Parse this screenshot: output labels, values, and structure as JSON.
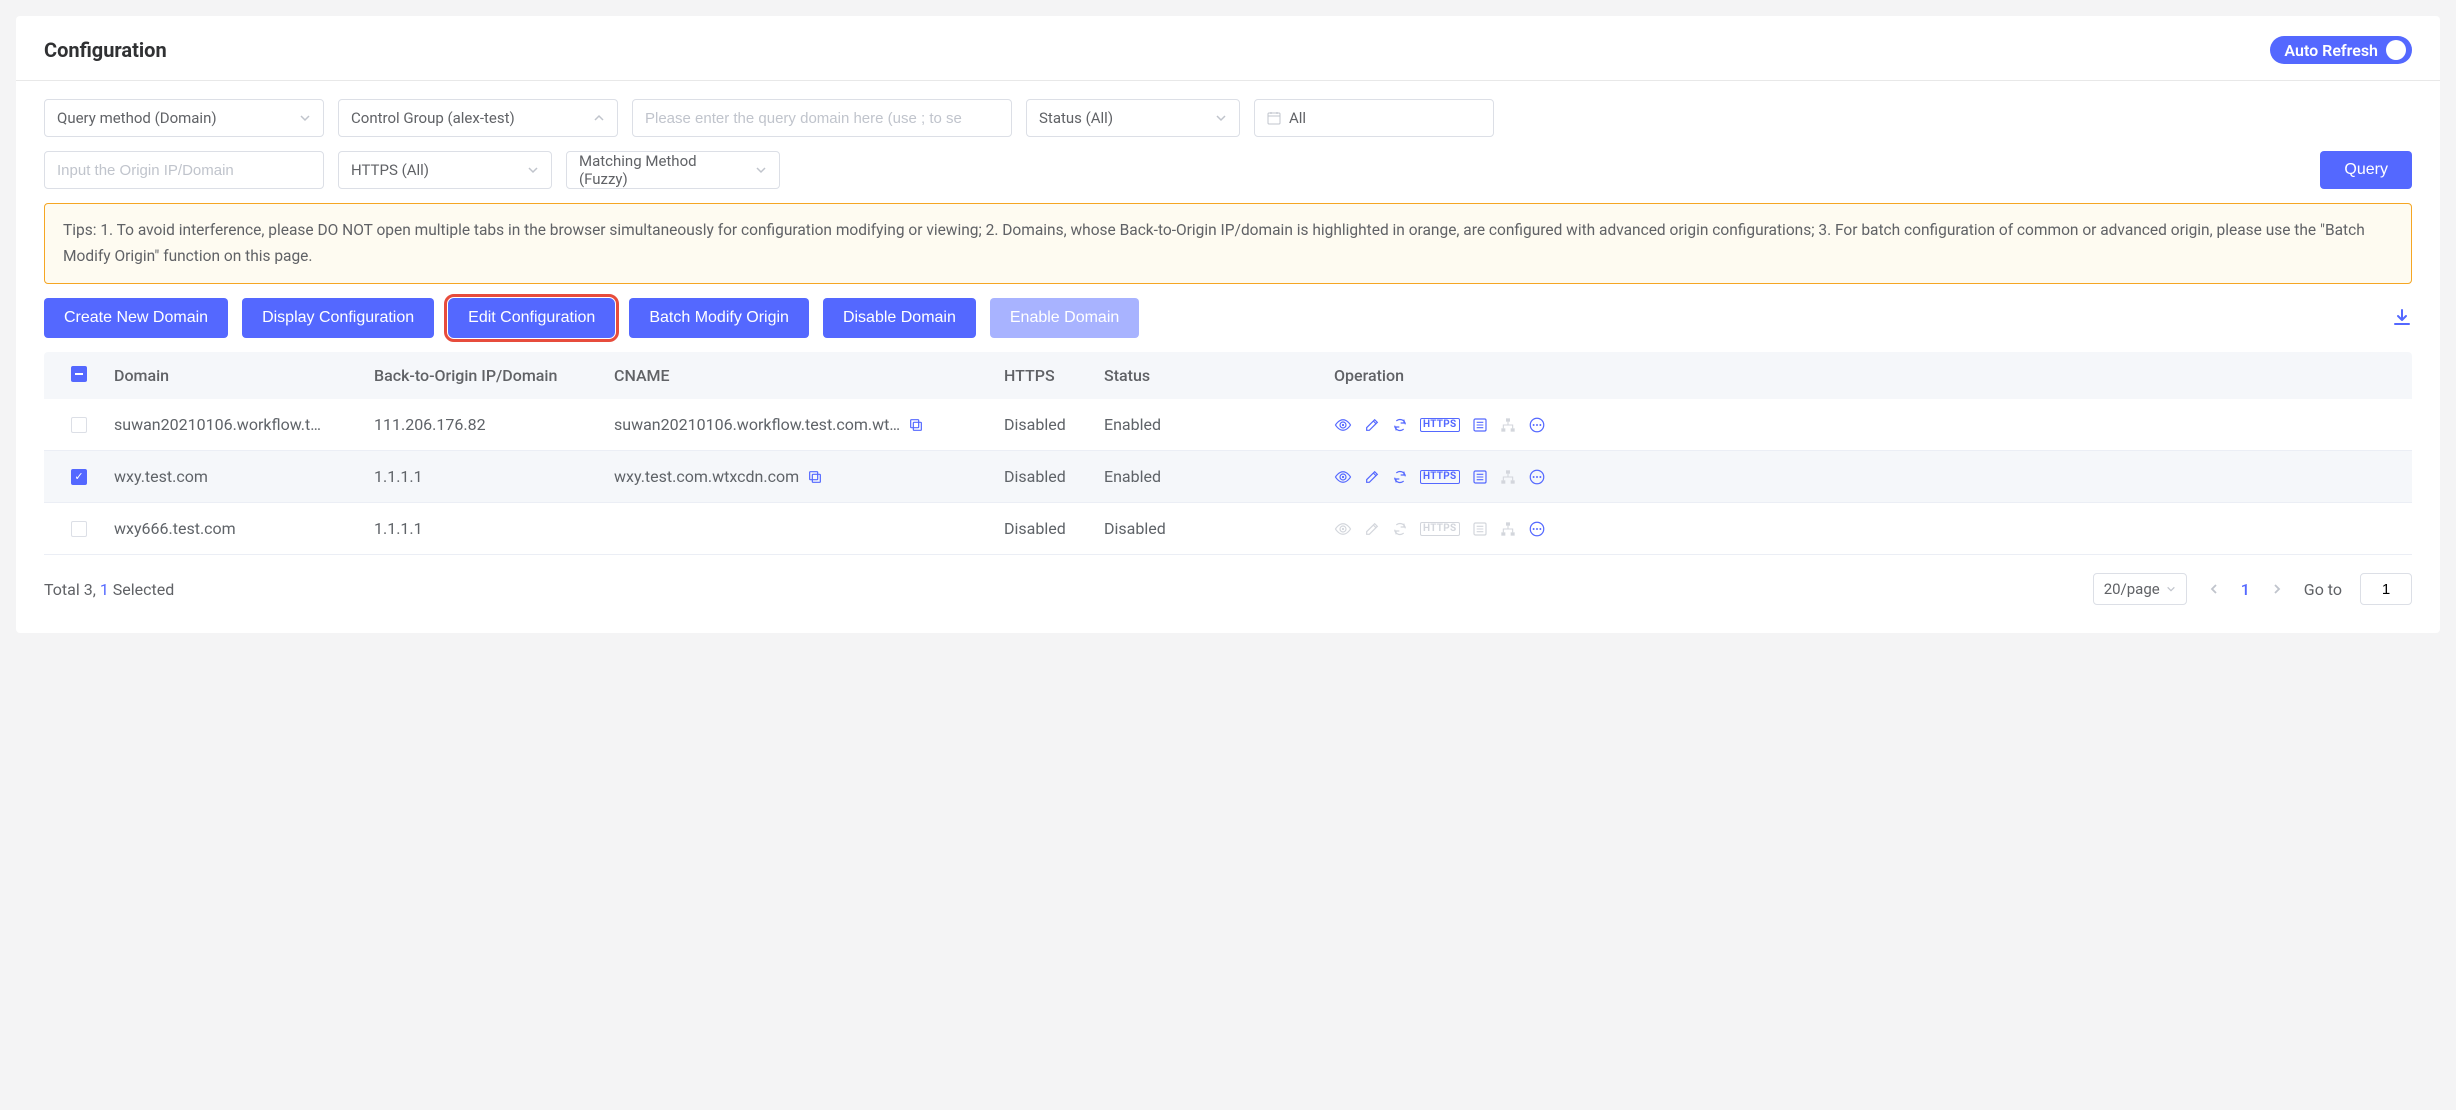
{
  "header": {
    "title": "Configuration",
    "auto_refresh_label": "Auto Refresh"
  },
  "filters": {
    "query_method": "Query method (Domain)",
    "control_group": "Control Group (alex-test)",
    "query_domain_placeholder": "Please enter the query domain here (use ; to se",
    "status": "Status (All)",
    "date_all": "All",
    "origin_placeholder": "Input the Origin IP/Domain",
    "https": "HTTPS (All)",
    "matching_method": "Matching Method (Fuzzy)",
    "query_btn": "Query"
  },
  "tips": "Tips: 1. To avoid interference, please DO NOT open multiple tabs in the browser simultaneously for configuration modifying or viewing; 2. Domains, whose Back-to-Origin IP/domain is highlighted in orange, are configured with advanced origin configurations; 3. For batch configuration of common or advanced origin, please use the \"Batch Modify Origin\" function on this page.",
  "actions": {
    "create": "Create New Domain",
    "display": "Display Configuration",
    "edit": "Edit Configuration",
    "batch": "Batch Modify Origin",
    "disable": "Disable Domain",
    "enable": "Enable Domain"
  },
  "columns": {
    "domain": "Domain",
    "origin": "Back-to-Origin IP/Domain",
    "cname": "CNAME",
    "https": "HTTPS",
    "status": "Status",
    "operation": "Operation"
  },
  "rows": [
    {
      "checked": false,
      "domain": "suwan20210106.workflow.t…",
      "origin": "111.206.176.82",
      "cname": "suwan20210106.workflow.test.com.wt…",
      "show_copy": true,
      "https": "Disabled",
      "status": "Enabled",
      "ops_enabled": true
    },
    {
      "checked": true,
      "domain": "wxy.test.com",
      "origin": "1.1.1.1",
      "cname": "wxy.test.com.wtxcdn.com",
      "show_copy": true,
      "https": "Disabled",
      "status": "Enabled",
      "ops_enabled": true
    },
    {
      "checked": false,
      "domain": "wxy666.test.com",
      "origin": "1.1.1.1",
      "cname": "",
      "show_copy": false,
      "https": "Disabled",
      "status": "Disabled",
      "ops_enabled": false
    }
  ],
  "footer": {
    "total_prefix": "Total ",
    "total_count": "3",
    "total_sep": ", ",
    "selected_count": "1",
    "selected_suffix": " Selected",
    "per_page": "20/page",
    "current_page": "1",
    "goto_label": "Go to",
    "goto_value": "1"
  },
  "icons": {
    "https_tag": "HTTPS"
  }
}
